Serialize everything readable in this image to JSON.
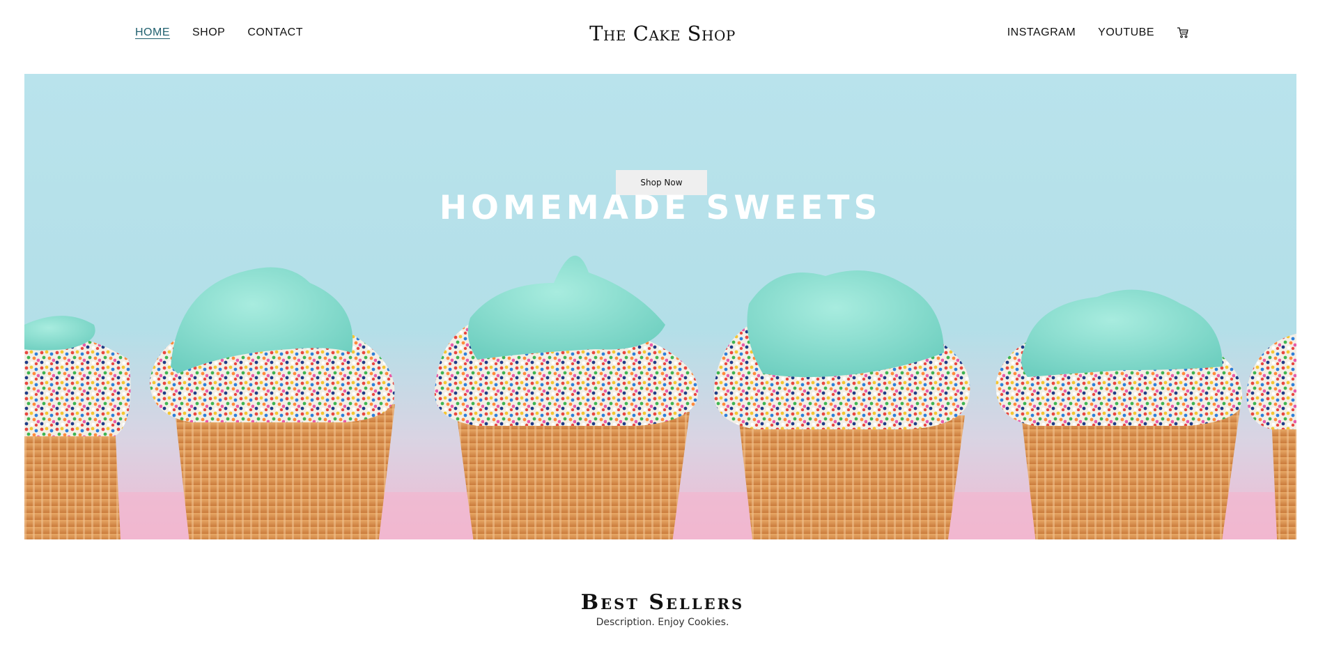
{
  "header": {
    "brand": "The Cake Shop",
    "nav_left": [
      {
        "label": "HOME",
        "active": true
      },
      {
        "label": "SHOP",
        "active": false
      },
      {
        "label": "CONTACT",
        "active": false
      }
    ],
    "nav_right": [
      {
        "label": "INSTAGRAM"
      },
      {
        "label": "YOUTUBE"
      }
    ],
    "cart_icon": "cart-icon",
    "active_color": "#1f5f6e"
  },
  "hero": {
    "title": "HOMEMADE SWEETS",
    "button_label": "Shop Now",
    "image": "cupcakes-with-mint-frosting-and-sprinkles",
    "colors": {
      "sky": "#b6e0e9",
      "table": "#f0b9d2",
      "frosting": "#8ddfd0",
      "liner": "#d98c45"
    }
  },
  "section": {
    "title": "Best Sellers",
    "description": "Description. Enjoy Cookies."
  }
}
